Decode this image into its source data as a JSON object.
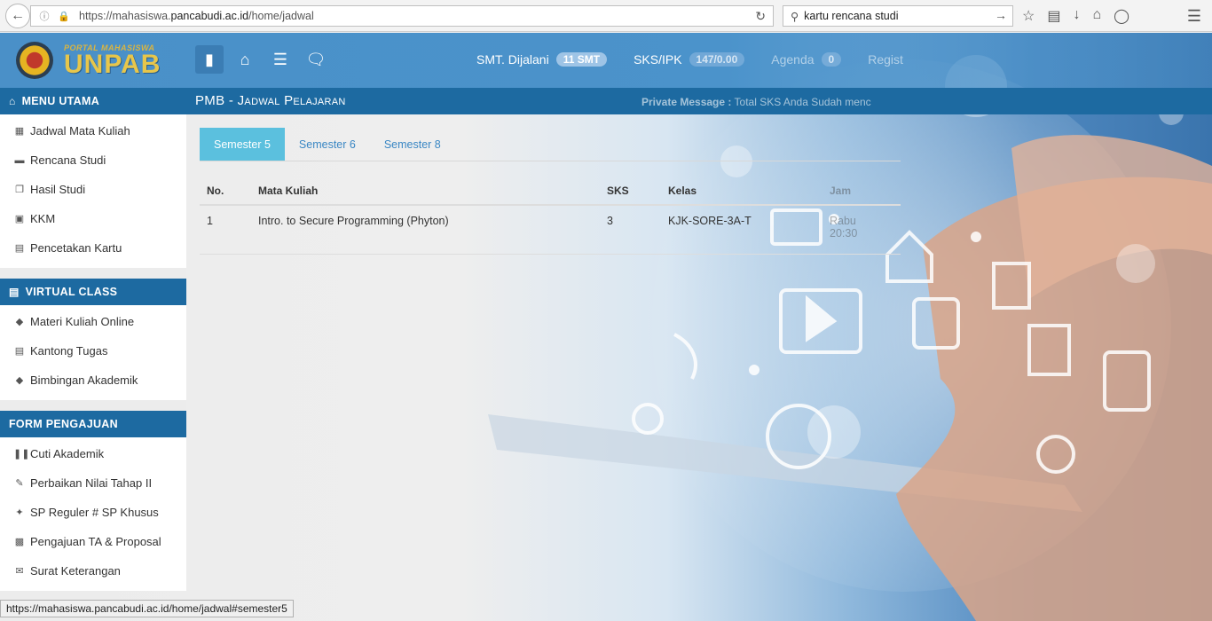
{
  "browser": {
    "url_prefix": "https://mahasiswa.",
    "url_domain": "pancabudi.ac.id",
    "url_path": "/home/jadwal",
    "search_value": "kartu rencana studi"
  },
  "header": {
    "logo_small": "PORTAL MAHASISWA",
    "logo_big": "UNPAB",
    "smt_label": "SMT. Dijalani",
    "smt_value": "11 SMT",
    "sks_label": "SKS/IPK",
    "sks_value": "147/0.00",
    "agenda_label": "Agenda",
    "agenda_value": "0",
    "extra_label": "Regist"
  },
  "sidebar": {
    "menu_utama": {
      "title": "MENU UTAMA",
      "items": [
        "Jadwal Mata Kuliah",
        "Rencana Studi",
        "Hasil Studi",
        "KKM",
        "Pencetakan Kartu"
      ]
    },
    "virtual_class": {
      "title": "VIRTUAL CLASS",
      "items": [
        "Materi Kuliah Online",
        "Kantong Tugas",
        "Bimbingan Akademik"
      ]
    },
    "form_pengajuan": {
      "title": "FORM PENGAJUAN",
      "items": [
        "Cuti Akademik",
        "Perbaikan Nilai Tahap II",
        "SP Reguler # SP Khusus",
        "Pengajuan TA & Proposal",
        "Surat Keterangan"
      ]
    }
  },
  "main": {
    "page_title": "PMB - Jadwal Pelajaran",
    "private_message_label": "Private Message :",
    "private_message_text": "Total SKS Anda Sudah menc",
    "tabs": [
      "Semester 5",
      "Semester 6",
      "Semester 8"
    ],
    "table": {
      "headers": [
        "No.",
        "Mata Kuliah",
        "SKS",
        "Kelas",
        "Jam"
      ],
      "rows": [
        {
          "no": "1",
          "mata_kuliah": "Intro. to Secure Programming (Phyton)",
          "sks": "3",
          "kelas": "KJK-SORE-3A-T",
          "jam_day": "Rabu",
          "jam_time": "20:30"
        }
      ]
    }
  },
  "status_bar": "https://mahasiswa.pancabudi.ac.id/home/jadwal#semester5"
}
